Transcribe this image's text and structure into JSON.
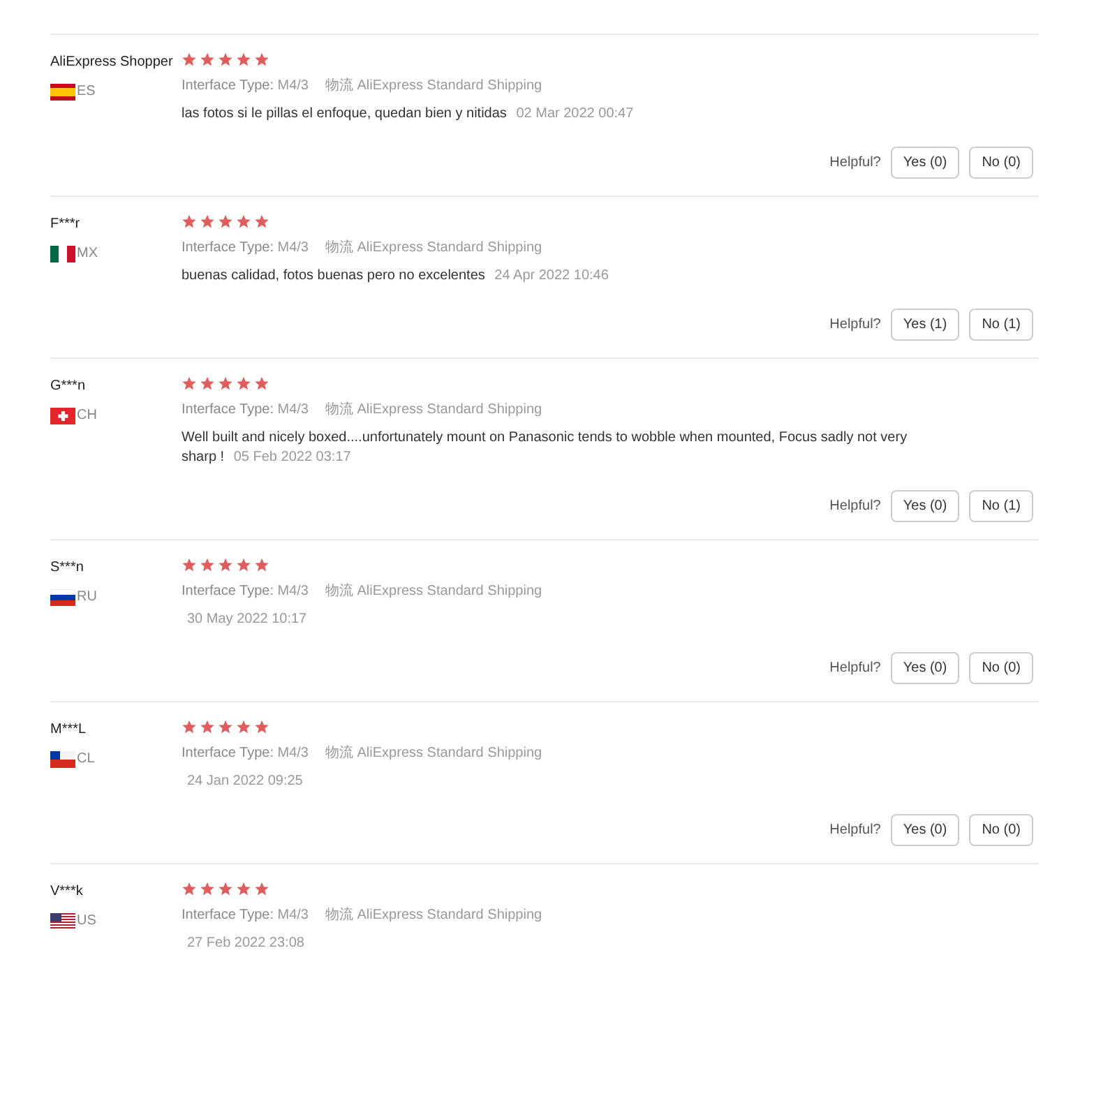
{
  "reviews": [
    {
      "name": "AliExpress Shopper",
      "kind": "es",
      "country": "ES",
      "stars": 5,
      "attr_label": "Interface Type:",
      "attr_value": "M4/3",
      "shipping_label": "物流",
      "shipping": "AliExpress Standard Shipping",
      "text": "las fotos si le pillas el enfoque, quedan bien y nitidas",
      "date": "02 Mar 2022 00:47",
      "helpful": "Helpful?",
      "yes": "Yes (0)",
      "no": "No (0)"
    },
    {
      "name": "F***r",
      "kind": "mx",
      "country": "MX",
      "stars": 5,
      "attr_label": "Interface Type:",
      "attr_value": "M4/3",
      "shipping_label": "物流",
      "shipping": "AliExpress Standard Shipping",
      "text": "buenas calidad, fotos buenas pero no excelentes",
      "date": "24 Apr 2022 10:46",
      "helpful": "Helpful?",
      "yes": "Yes (1)",
      "no": "No (1)"
    },
    {
      "name": "G***n",
      "kind": "ch",
      "country": "CH",
      "stars": 5,
      "attr_label": "Interface Type:",
      "attr_value": "M4/3",
      "shipping_label": "物流",
      "shipping": "AliExpress Standard Shipping",
      "text": "Well built and nicely boxed....unfortunately mount on Panasonic tends to wobble when mounted, Focus sadly not very sharp !",
      "date": "05 Feb 2022 03:17",
      "helpful": "Helpful?",
      "yes": "Yes (0)",
      "no": "No (1)"
    },
    {
      "name": "S***n",
      "kind": "ru",
      "country": "RU",
      "stars": 5,
      "attr_label": "Interface Type:",
      "attr_value": "M4/3",
      "shipping_label": "物流",
      "shipping": "AliExpress Standard Shipping",
      "date": "30 May 2022 10:17",
      "helpful": "Helpful?",
      "yes": "Yes (0)",
      "no": "No (0)"
    },
    {
      "name": "M***L",
      "kind": "cl",
      "country": "CL",
      "stars": 5,
      "attr_label": "Interface Type:",
      "attr_value": "M4/3",
      "shipping_label": "物流",
      "shipping": "AliExpress Standard Shipping",
      "date": "24 Jan 2022 09:25",
      "helpful": "Helpful?",
      "yes": "Yes (0)",
      "no": "No (0)"
    },
    {
      "name": "V***k",
      "kind": "us",
      "country": "US",
      "stars": 5,
      "attr_label": "Interface Type:",
      "attr_value": "M4/3",
      "shipping_label": "物流",
      "shipping": "AliExpress Standard Shipping",
      "date": "27 Feb 2022 23:08"
    }
  ]
}
